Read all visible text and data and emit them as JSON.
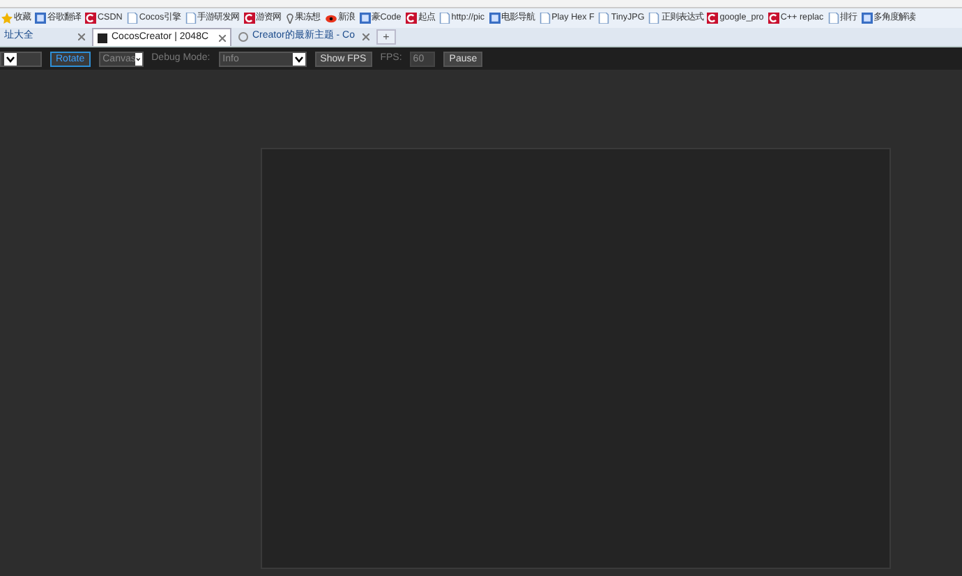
{
  "bookmarks": [
    {
      "label": "收藏"
    },
    {
      "label": "谷歌翻译"
    },
    {
      "label": "CSDN"
    },
    {
      "label": "Cocos引擎"
    },
    {
      "label": "手游研发网"
    },
    {
      "label": "游资网"
    },
    {
      "label": "果冻想"
    },
    {
      "label": "新浪"
    },
    {
      "label": "豪Code"
    },
    {
      "label": "起点"
    },
    {
      "label": "http://pic"
    },
    {
      "label": "电影导航"
    },
    {
      "label": "Play Hex F"
    },
    {
      "label": "TinyJPG"
    },
    {
      "label": "正则表达式"
    },
    {
      "label": "google_pro"
    },
    {
      "label": "C++ replac"
    },
    {
      "label": "排行"
    },
    {
      "label": "多角度解读"
    }
  ],
  "tabs": [
    {
      "label": "址大全",
      "selected": false
    },
    {
      "label": "CocosCreator | 2048C",
      "selected": true
    },
    {
      "label": "Creator的最新主题 - Co",
      "selected": false
    }
  ],
  "new_tab": "+",
  "toolbar": {
    "rotate": "Rotate",
    "canvas": "Canvas",
    "debug_label": "Debug Mode:",
    "debug_value": "Info",
    "show_fps": "Show FPS",
    "fps_label": "FPS:",
    "fps_value": "60",
    "pause": "Pause"
  }
}
